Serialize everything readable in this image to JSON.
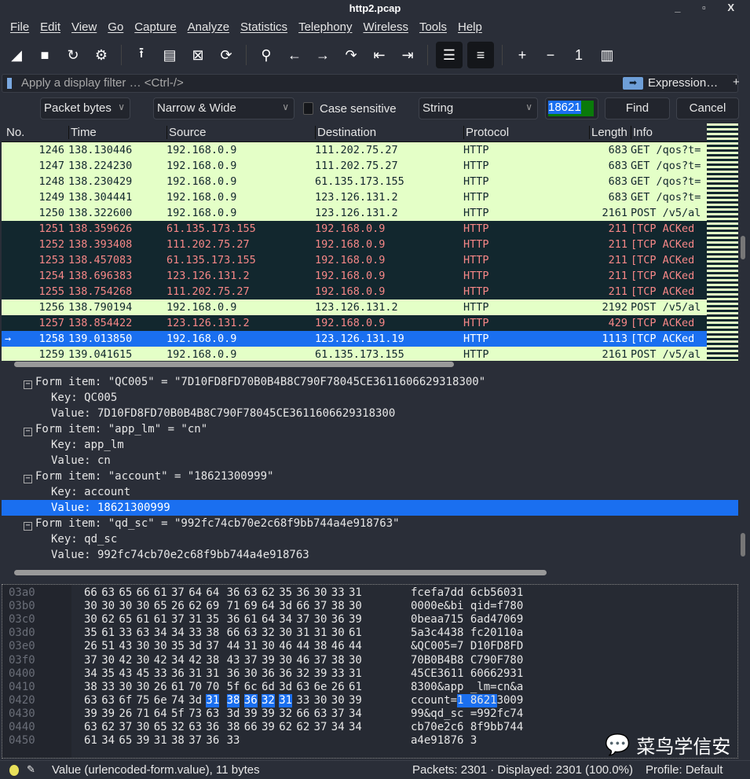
{
  "window": {
    "title": "http2.pcap",
    "controls": "_ ▫ X"
  },
  "menu": [
    "File",
    "Edit",
    "View",
    "Go",
    "Capture",
    "Analyze",
    "Statistics",
    "Telephony",
    "Wireless",
    "Tools",
    "Help"
  ],
  "toolbar": [
    {
      "icon": "shark-fin-start-icon",
      "glyph": "◢"
    },
    {
      "icon": "stop-icon",
      "glyph": "■"
    },
    {
      "icon": "restart-icon",
      "glyph": "↻"
    },
    {
      "icon": "capture-options-gear-icon",
      "glyph": "⚙"
    },
    {
      "icon": "open-file-icon",
      "glyph": "⭱"
    },
    {
      "icon": "save-file-icon",
      "glyph": "▤"
    },
    {
      "icon": "close-file-icon",
      "glyph": "⊠"
    },
    {
      "icon": "reload-file-icon",
      "glyph": "⟳"
    },
    {
      "icon": "find-packet-icon",
      "glyph": "⚲"
    },
    {
      "icon": "go-back-icon",
      "glyph": "←"
    },
    {
      "icon": "go-forward-icon",
      "glyph": "→"
    },
    {
      "icon": "go-to-packet-icon",
      "glyph": "↷"
    },
    {
      "icon": "first-packet-icon",
      "glyph": "⇤"
    },
    {
      "icon": "last-packet-icon",
      "glyph": "⇥"
    },
    {
      "icon": "auto-scroll-icon",
      "glyph": "☰"
    },
    {
      "icon": "colorize-icon",
      "glyph": "≡"
    },
    {
      "icon": "zoom-in-icon",
      "glyph": "+"
    },
    {
      "icon": "zoom-out-icon",
      "glyph": "−"
    },
    {
      "icon": "normal-size-icon",
      "glyph": "1"
    },
    {
      "icon": "resize-columns-icon",
      "glyph": "▥"
    }
  ],
  "filter": {
    "placeholder": "Apply a display filter … <Ctrl-/>",
    "expression_label": "Expression…",
    "plus": "+"
  },
  "find": {
    "search_in": "Packet bytes",
    "char_width": "Narrow & Wide",
    "case_sensitive_label": "Case sensitive",
    "case_sensitive": false,
    "search_type": "String",
    "value": "18621",
    "find_label": "Find",
    "cancel_label": "Cancel"
  },
  "packet_list": {
    "columns": [
      "No.",
      "Time",
      "Source",
      "Destination",
      "Protocol",
      "Length",
      "Info"
    ],
    "rows": [
      {
        "no": "1246",
        "time": "138.130446",
        "src": "192.168.0.9",
        "dst": "111.202.75.27",
        "proto": "HTTP",
        "len": "683",
        "info": "GET /qos?t=",
        "style": "light"
      },
      {
        "no": "1247",
        "time": "138.224230",
        "src": "192.168.0.9",
        "dst": "111.202.75.27",
        "proto": "HTTP",
        "len": "683",
        "info": "GET /qos?t=",
        "style": "light"
      },
      {
        "no": "1248",
        "time": "138.230429",
        "src": "192.168.0.9",
        "dst": "61.135.173.155",
        "proto": "HTTP",
        "len": "683",
        "info": "GET /qos?t=",
        "style": "light"
      },
      {
        "no": "1249",
        "time": "138.304441",
        "src": "192.168.0.9",
        "dst": "123.126.131.2",
        "proto": "HTTP",
        "len": "683",
        "info": "GET /qos?t=",
        "style": "light"
      },
      {
        "no": "1250",
        "time": "138.322600",
        "src": "192.168.0.9",
        "dst": "123.126.131.2",
        "proto": "HTTP",
        "len": "2161",
        "info": "POST /v5/al",
        "style": "light"
      },
      {
        "no": "1251",
        "time": "138.359626",
        "src": "61.135.173.155",
        "dst": "192.168.0.9",
        "proto": "HTTP",
        "len": "211",
        "info": "[TCP ACKed",
        "style": "dark"
      },
      {
        "no": "1252",
        "time": "138.393408",
        "src": "111.202.75.27",
        "dst": "192.168.0.9",
        "proto": "HTTP",
        "len": "211",
        "info": "[TCP ACKed",
        "style": "dark"
      },
      {
        "no": "1253",
        "time": "138.457083",
        "src": "61.135.173.155",
        "dst": "192.168.0.9",
        "proto": "HTTP",
        "len": "211",
        "info": "[TCP ACKed",
        "style": "dark"
      },
      {
        "no": "1254",
        "time": "138.696383",
        "src": "123.126.131.2",
        "dst": "192.168.0.9",
        "proto": "HTTP",
        "len": "211",
        "info": "[TCP ACKed",
        "style": "dark"
      },
      {
        "no": "1255",
        "time": "138.754268",
        "src": "111.202.75.27",
        "dst": "192.168.0.9",
        "proto": "HTTP",
        "len": "211",
        "info": "[TCP ACKed",
        "style": "dark"
      },
      {
        "no": "1256",
        "time": "138.790194",
        "src": "192.168.0.9",
        "dst": "123.126.131.2",
        "proto": "HTTP",
        "len": "2192",
        "info": "POST /v5/al",
        "style": "light"
      },
      {
        "no": "1257",
        "time": "138.854422",
        "src": "123.126.131.2",
        "dst": "192.168.0.9",
        "proto": "HTTP",
        "len": "429",
        "info": "[TCP ACKed",
        "style": "dark"
      },
      {
        "no": "1258",
        "time": "139.013850",
        "src": "192.168.0.9",
        "dst": "123.126.131.19",
        "proto": "HTTP",
        "len": "1113",
        "info": "[TCP ACKed",
        "style": "sel"
      },
      {
        "no": "1259",
        "time": "139.041615",
        "src": "192.168.0.9",
        "dst": "61.135.173.155",
        "proto": "HTTP",
        "len": "2161",
        "info": "POST /v5/al",
        "style": "light"
      }
    ]
  },
  "details": [
    {
      "text": "Form item: \"QC005\" = \"7D10FD8FD70B0B4B8C790F78045CE3611606629318300\"",
      "level": 0,
      "toggle": "−"
    },
    {
      "text": "Key: QC005",
      "level": 1
    },
    {
      "text": "Value: 7D10FD8FD70B0B4B8C790F78045CE3611606629318300",
      "level": 1
    },
    {
      "text": "Form item: \"app_lm\" = \"cn\"",
      "level": 0,
      "toggle": "−"
    },
    {
      "text": "Key: app_lm",
      "level": 1
    },
    {
      "text": "Value: cn",
      "level": 1
    },
    {
      "text": "Form item: \"account\" = \"18621300999\"",
      "level": 0,
      "toggle": "−"
    },
    {
      "text": "Key: account",
      "level": 1
    },
    {
      "text": "Value: 18621300999",
      "level": 1,
      "selected": true
    },
    {
      "text": "Form item: \"qd_sc\" = \"992fc74cb70e2c68f9bb744a4e918763\"",
      "level": 0,
      "toggle": "−"
    },
    {
      "text": "Key: qd_sc",
      "level": 1
    },
    {
      "text": "Value: 992fc74cb70e2c68f9bb744a4e918763",
      "level": 1
    }
  ],
  "hex": {
    "rows": [
      {
        "off": "03a0",
        "bytes": [
          "66",
          "63",
          "65",
          "66",
          "61",
          "37",
          "64",
          "64",
          "36",
          "63",
          "62",
          "35",
          "36",
          "30",
          "33",
          "31"
        ],
        "ascii": "fcefa7dd 6cb56031"
      },
      {
        "off": "03b0",
        "bytes": [
          "30",
          "30",
          "30",
          "30",
          "65",
          "26",
          "62",
          "69",
          "71",
          "69",
          "64",
          "3d",
          "66",
          "37",
          "38",
          "30"
        ],
        "ascii": "0000e&bi qid=f780"
      },
      {
        "off": "03c0",
        "bytes": [
          "30",
          "62",
          "65",
          "61",
          "61",
          "37",
          "31",
          "35",
          "36",
          "61",
          "64",
          "34",
          "37",
          "30",
          "36",
          "39"
        ],
        "ascii": "0beaa715 6ad47069"
      },
      {
        "off": "03d0",
        "bytes": [
          "35",
          "61",
          "33",
          "63",
          "34",
          "34",
          "33",
          "38",
          "66",
          "63",
          "32",
          "30",
          "31",
          "31",
          "30",
          "61"
        ],
        "ascii": "5a3c4438 fc20110a"
      },
      {
        "off": "03e0",
        "bytes": [
          "26",
          "51",
          "43",
          "30",
          "30",
          "35",
          "3d",
          "37",
          "44",
          "31",
          "30",
          "46",
          "44",
          "38",
          "46",
          "44"
        ],
        "ascii": "&QC005=7 D10FD8FD"
      },
      {
        "off": "03f0",
        "bytes": [
          "37",
          "30",
          "42",
          "30",
          "42",
          "34",
          "42",
          "38",
          "43",
          "37",
          "39",
          "30",
          "46",
          "37",
          "38",
          "30"
        ],
        "ascii": "70B0B4B8 C790F780"
      },
      {
        "off": "0400",
        "bytes": [
          "34",
          "35",
          "43",
          "45",
          "33",
          "36",
          "31",
          "31",
          "36",
          "30",
          "36",
          "36",
          "32",
          "39",
          "33",
          "31"
        ],
        "ascii": "45CE3611 60662931"
      },
      {
        "off": "0410",
        "bytes": [
          "38",
          "33",
          "30",
          "30",
          "26",
          "61",
          "70",
          "70",
          "5f",
          "6c",
          "6d",
          "3d",
          "63",
          "6e",
          "26",
          "61"
        ],
        "ascii": "8300&app _lm=cn&a"
      },
      {
        "off": "0420",
        "bytes": [
          "63",
          "63",
          "6f",
          "75",
          "6e",
          "74",
          "3d",
          "31",
          "38",
          "36",
          "32",
          "31",
          "33",
          "30",
          "30",
          "39"
        ],
        "ascii": "ccount=1 86213009",
        "highlight": [
          7,
          11
        ]
      },
      {
        "off": "0430",
        "bytes": [
          "39",
          "39",
          "26",
          "71",
          "64",
          "5f",
          "73",
          "63",
          "3d",
          "39",
          "39",
          "32",
          "66",
          "63",
          "37",
          "34"
        ],
        "ascii": "99&qd_sc =992fc74"
      },
      {
        "off": "0440",
        "bytes": [
          "63",
          "62",
          "37",
          "30",
          "65",
          "32",
          "63",
          "36",
          "38",
          "66",
          "39",
          "62",
          "62",
          "37",
          "34",
          "34"
        ],
        "ascii": "cb70e2c6 8f9bb744"
      },
      {
        "off": "0450",
        "bytes": [
          "61",
          "34",
          "65",
          "39",
          "31",
          "38",
          "37",
          "36",
          "33"
        ],
        "ascii": "a4e91876 3"
      }
    ]
  },
  "watermark": "菜鸟学信安",
  "status": {
    "field": "Value (urlencoded-form.value), 11 bytes",
    "packets": "Packets: 2301 · Displayed: 2301 (100.0%)",
    "profile": "Profile: Default",
    "colors": {
      "expert": "#e8e05a"
    }
  }
}
